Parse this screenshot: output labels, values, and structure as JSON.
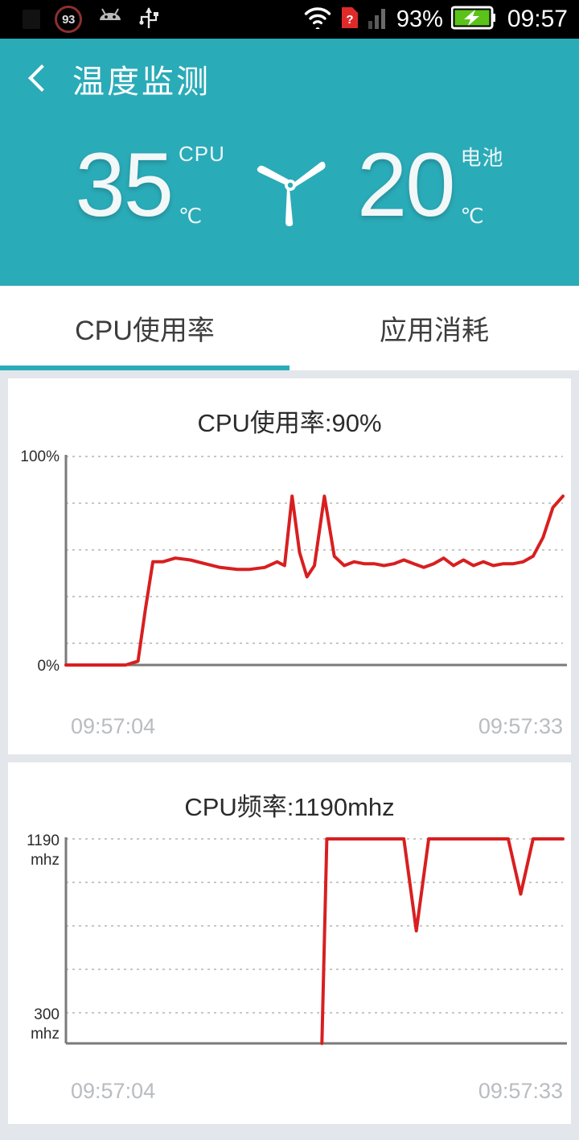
{
  "statusbar": {
    "battery_ring_value": "93",
    "icons": [
      "notification-icon",
      "battery-circle-icon",
      "android-icon",
      "usb-icon",
      "wifi-icon",
      "sim-question-icon",
      "signal-bars-icon",
      "battery-charging-icon"
    ],
    "battery_percent": "93%",
    "time": "09:57"
  },
  "header": {
    "back_label": "back",
    "title": "温度监测",
    "cpu": {
      "value": "35",
      "label": "CPU",
      "unit": "℃"
    },
    "battery": {
      "value": "20",
      "label": "电池",
      "unit": "℃"
    },
    "fan_icon": "fan-icon",
    "accent_color": "#2aabb8"
  },
  "tabs": [
    {
      "label": "CPU使用率",
      "active": true
    },
    {
      "label": "应用消耗",
      "active": false
    }
  ],
  "chart_data": [
    {
      "type": "line",
      "title": "CPU使用率:90%",
      "xlabel": "",
      "ylabel": "",
      "ylim": [
        0,
        100
      ],
      "ytick_labels": [
        "100%",
        "0%"
      ],
      "xtick_labels": [
        "09:57:04",
        "09:57:33"
      ],
      "x_start_time": "09:57:04",
      "x_end_time": "09:57:33",
      "grid": true,
      "gridline_count": 5,
      "line_color": "#d81f20",
      "series": [
        {
          "name": "CPU使用率",
          "x": [
            0,
            12,
            14.5,
            16,
            17.5,
            19.5,
            22,
            25,
            28,
            31,
            34.5,
            37,
            40,
            42.5,
            44,
            45.5,
            47,
            48.5,
            50,
            52,
            54,
            56,
            58,
            60,
            62,
            64,
            66,
            68,
            70,
            72,
            74,
            76,
            78,
            80,
            82,
            84,
            86,
            88,
            90,
            92,
            94,
            96,
            98,
            100
          ],
          "values": [
            0,
            0,
            2,
            30,
            55,
            55,
            57,
            56,
            54,
            52,
            51,
            51,
            52,
            55,
            53,
            90,
            60,
            47,
            53,
            90,
            58,
            53,
            55,
            54,
            54,
            53,
            54,
            56,
            54,
            52,
            54,
            57,
            53,
            56,
            53,
            55,
            53,
            54,
            54,
            55,
            58,
            68,
            84,
            90
          ]
        }
      ]
    },
    {
      "type": "line",
      "title": "CPU频率:1190mhz",
      "xlabel": "",
      "ylabel": "",
      "ylim": [
        300,
        1190
      ],
      "ytick_labels": [
        "1190\nmhz",
        "300\nmhz"
      ],
      "ytick_top_value": "1190",
      "ytick_top_unit": "mhz",
      "ytick_bottom_value": "300",
      "ytick_bottom_unit": "mhz",
      "xtick_labels": [
        "09:57:04",
        "09:57:33"
      ],
      "x_start_time": "09:57:04",
      "x_end_time": "09:57:33",
      "grid": true,
      "gridline_count": 5,
      "line_color": "#d81f20",
      "series": [
        {
          "name": "CPU频率",
          "x": [
            51.5,
            52.5,
            55,
            65,
            68,
            70.5,
            73,
            76,
            89,
            91.5,
            94,
            96,
            100
          ],
          "values": [
            300,
            1190,
            1190,
            1190,
            1190,
            790,
            1190,
            1190,
            1190,
            950,
            1190,
            1190,
            1190
          ]
        }
      ]
    }
  ]
}
